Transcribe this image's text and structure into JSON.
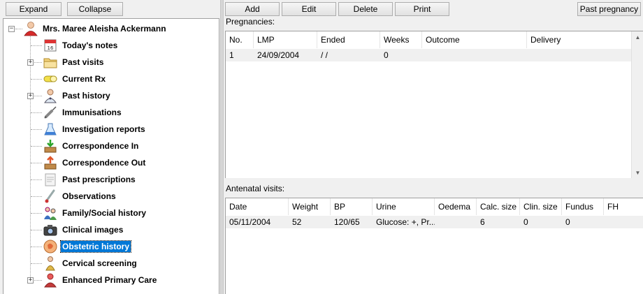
{
  "tree_toolbar": {
    "expand_label": "Expand",
    "collapse_label": "Collapse"
  },
  "tree": {
    "patient": "Mrs. Maree Aleisha Ackermann",
    "items": [
      {
        "label": "Today's notes",
        "icon": "calendar-icon",
        "expandable": false,
        "selected": false
      },
      {
        "label": "Past visits",
        "icon": "folder-icon",
        "expandable": true,
        "selected": false
      },
      {
        "label": "Current Rx",
        "icon": "pill-icon",
        "expandable": false,
        "selected": false
      },
      {
        "label": "Past history",
        "icon": "doctor-icon",
        "expandable": true,
        "selected": false
      },
      {
        "label": "Immunisations",
        "icon": "syringe-icon",
        "expandable": false,
        "selected": false
      },
      {
        "label": "Investigation reports",
        "icon": "flask-icon",
        "expandable": false,
        "selected": false
      },
      {
        "label": "Correspondence In",
        "icon": "inbox-icon",
        "expandable": false,
        "selected": false
      },
      {
        "label": "Correspondence Out",
        "icon": "outbox-icon",
        "expandable": false,
        "selected": false
      },
      {
        "label": "Past prescriptions",
        "icon": "prescription-icon",
        "expandable": false,
        "selected": false
      },
      {
        "label": "Observations",
        "icon": "thermometer-icon",
        "expandable": false,
        "selected": false
      },
      {
        "label": "Family/Social history",
        "icon": "family-icon",
        "expandable": false,
        "selected": false
      },
      {
        "label": "Clinical images",
        "icon": "camera-icon",
        "expandable": false,
        "selected": false
      },
      {
        "label": "Obstetric history",
        "icon": "fetus-icon",
        "expandable": false,
        "selected": true
      },
      {
        "label": "Cervical screening",
        "icon": "person-icon",
        "expandable": false,
        "selected": false
      },
      {
        "label": "Enhanced Primary Care",
        "icon": "care-icon",
        "expandable": true,
        "selected": false
      }
    ]
  },
  "toolbar": {
    "add_label": "Add",
    "edit_label": "Edit",
    "delete_label": "Delete",
    "print_label": "Print",
    "past_pregnancy_label": "Past pregnancy"
  },
  "pregnancies": {
    "label": "Pregnancies:",
    "columns": [
      "No.",
      "LMP",
      "Ended",
      "Weeks",
      "Outcome",
      "Delivery"
    ],
    "rows": [
      [
        "1",
        "24/09/2004",
        " /  /",
        "0",
        "",
        ""
      ]
    ]
  },
  "antenatal": {
    "label": "Antenatal visits:",
    "columns": [
      "Date",
      "Weight",
      "BP",
      "Urine",
      "Oedema",
      "Calc. size",
      "Clin. size",
      "Fundus",
      "FH"
    ],
    "rows": [
      [
        "05/11/2004",
        "52",
        "120/65",
        "Glucose: +, Pr...",
        "",
        "6",
        "0",
        "0",
        ""
      ]
    ]
  },
  "colors": {
    "selection": "#0078d7",
    "row_bg": "#f0f0f0",
    "border": "#a0a0a0"
  }
}
